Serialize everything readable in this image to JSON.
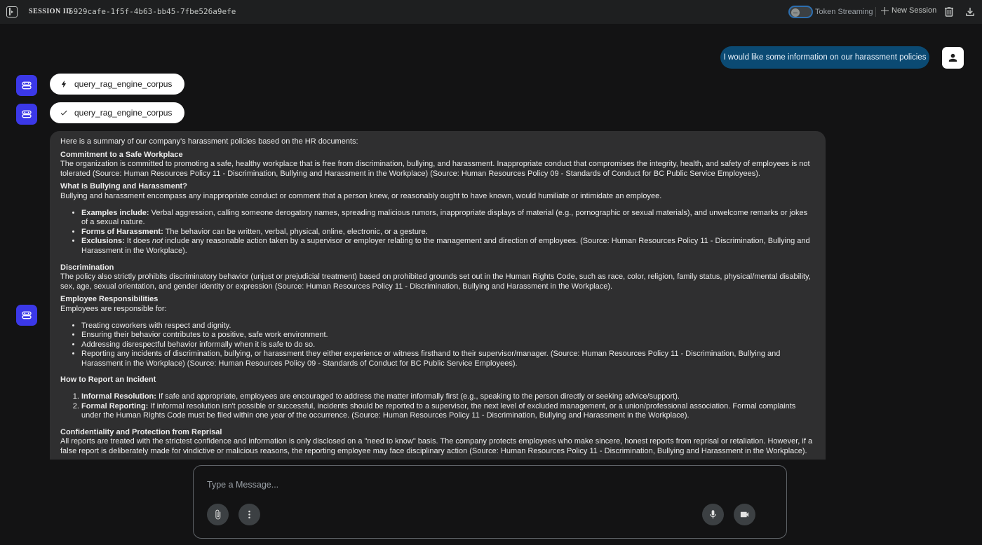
{
  "header": {
    "session_label": "SESSION ID",
    "session_id": "5929cafe-1f5f-4b63-bb45-7fbe526a9efe",
    "token_streaming_label": "Token Streaming",
    "new_session_label": "New Session",
    "icons": [
      "sidebar-toggle-icon",
      "trash-icon",
      "download-icon"
    ]
  },
  "user_message": "I would like some information on our harassment policies",
  "tool_calls": [
    {
      "name": "query_rag_engine_corpus",
      "status": "running",
      "icon": "bolt-icon"
    },
    {
      "name": "query_rag_engine_corpus",
      "status": "done",
      "icon": "check-icon"
    }
  ],
  "response": {
    "intro": "Here is a summary of our company's harassment policies based on the HR documents:",
    "commitment": {
      "title": "Commitment to a Safe Workplace",
      "body": "The organization is committed to promoting a safe, healthy workplace that is free from discrimination, bullying, and harassment. Inappropriate conduct that compromises the integrity, health, and safety of employees is not tolerated (Source: Human Resources Policy 11 - Discrimination, Bullying and Harassment in the Workplace) (Source: Human Resources Policy 09 - Standards of Conduct for BC Public Service Employees)."
    },
    "what_is": {
      "title": "What is Bullying and Harassment?",
      "body": "Bullying and harassment encompass any inappropriate conduct or comment that a person knew, or reasonably ought to have known, would humiliate or intimidate an employee.",
      "items": [
        {
          "label": "Examples include:",
          "text": " Verbal aggression, calling someone derogatory names, spreading malicious rumors, inappropriate displays of material (e.g., pornographic or sexual materials), and unwelcome remarks or jokes of a sexual nature."
        },
        {
          "label": "Forms of Harassment:",
          "text": " The behavior can be written, verbal, physical, online, electronic, or a gesture."
        },
        {
          "label": "Exclusions:",
          "text_before": " It does ",
          "emph": "not",
          "text_after": " include any reasonable action taken by a supervisor or employer relating to the management and direction of employees. (Source: Human Resources Policy 11 - Discrimination, Bullying and Harassment in the Workplace)."
        }
      ]
    },
    "discrimination": {
      "title": "Discrimination",
      "body": "The policy also strictly prohibits discriminatory behavior (unjust or prejudicial treatment) based on prohibited grounds set out in the Human Rights Code, such as race, color, religion, family status, physical/mental disability, sex, age, sexual orientation, and gender identity or expression (Source: Human Resources Policy 11 - Discrimination, Bullying and Harassment in the Workplace)."
    },
    "responsibilities": {
      "title": "Employee Responsibilities",
      "body": "Employees are responsible for:",
      "items": [
        "Treating coworkers with respect and dignity.",
        "Ensuring their behavior contributes to a positive, safe work environment.",
        "Addressing disrespectful behavior informally when it is safe to do so.",
        "Reporting any incidents of discrimination, bullying, or harassment they either experience or witness firsthand to their supervisor/manager. (Source: Human Resources Policy 11 - Discrimination, Bullying and Harassment in the Workplace) (Source: Human Resources Policy 09 - Standards of Conduct for BC Public Service Employees)."
      ]
    },
    "report": {
      "title": "How to Report an Incident",
      "items": [
        {
          "label": "Informal Resolution:",
          "text": " If safe and appropriate, employees are encouraged to address the matter informally first (e.g., speaking to the person directly or seeking advice/support)."
        },
        {
          "label": "Formal Reporting:",
          "text": " If informal resolution isn't possible or successful, incidents should be reported to a supervisor, the next level of excluded management, or a union/professional association. Formal complaints under the Human Rights Code must be filed within one year of the occurrence. (Source: Human Resources Policy 11 - Discrimination, Bullying and Harassment in the Workplace)."
        }
      ]
    },
    "confidentiality": {
      "title": "Confidentiality and Protection from Reprisal",
      "body": "All reports are treated with the strictest confidence and information is only disclosed on a \"need to know\" basis. The company protects employees who make sincere, honest reports from reprisal or retaliation. However, if a false report is deliberately made for vindictive or malicious reasons, the reporting employee may face disciplinary action (Source: Human Resources Policy 11 - Discrimination, Bullying and Harassment in the Workplace)."
    }
  },
  "composer": {
    "placeholder": "Type a Message...",
    "icons": [
      "paperclip-icon",
      "more-vert-icon",
      "mic-icon",
      "video-icon"
    ]
  },
  "colors": {
    "background": "#131314",
    "topbar": "#1e1f20",
    "user_bubble": "#0b4a73",
    "bot_avatar": "#3b38e8",
    "response_bg": "#2f2f30"
  }
}
